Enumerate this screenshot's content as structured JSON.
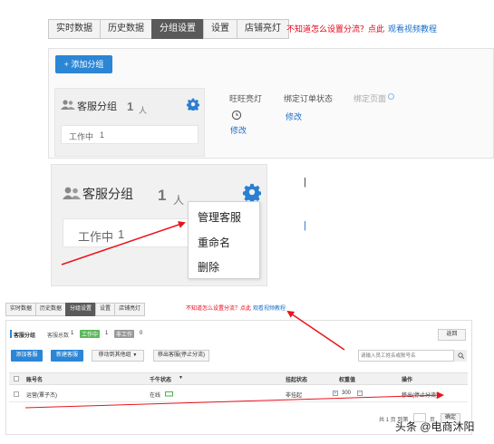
{
  "tabs": [
    "实时数据",
    "历史数据",
    "分组设置",
    "设置",
    "店铺亮灯"
  ],
  "active_tab": 2,
  "tip": {
    "text": "不知道怎么设置分流？点此",
    "link": "观看视频教程"
  },
  "panel1": {
    "add_button": "+ 添加分组",
    "group": {
      "name": "客服分组",
      "count": "1",
      "unit": "人",
      "status": "工作中",
      "status_count": "1"
    },
    "columns": [
      {
        "label": "旺旺亮灯",
        "action": "修改"
      },
      {
        "label": "绑定订单状态",
        "action": "修改"
      },
      {
        "label": "绑定页面",
        "action": ""
      }
    ]
  },
  "zoom": {
    "group": {
      "name": "客服分组",
      "count": "1",
      "unit": "人",
      "status": "工作中",
      "status_count": "1"
    },
    "menu": [
      "管理客服",
      "重命名",
      "删除"
    ]
  },
  "lower": {
    "tabs": [
      "实时数据",
      "历史数据",
      "分组设置",
      "设置",
      "店铺亮灯"
    ],
    "tip": {
      "text": "不知道怎么设置分流？点此",
      "link": "观看视频教程"
    },
    "group_label": "客服分组",
    "total_label": "客服总数",
    "total_value": "1",
    "working_badge": "工作中",
    "working_value": "1",
    "rest_badge": "非工作",
    "rest_value": "0",
    "back_button": "返回",
    "add_button": "添加客服",
    "create_button": "新建客服",
    "move_button": "移动到其他组",
    "remove_button": "移出客服(停止分流)",
    "search_placeholder": "请输入员工姓名或账号名",
    "headers": [
      "账号名",
      "千牛状态",
      "挂起状态",
      "权重值",
      "操作"
    ],
    "row": {
      "account": "运营(覃子杰)",
      "status": "在线",
      "suspend": "非挂起",
      "weight": "300",
      "action": "移出(停止分流)"
    },
    "pager": {
      "text1": "共 1 页 到第",
      "text2": "页",
      "confirm": "确定"
    }
  },
  "watermark": "头条 @电商沐阳",
  "colors": {
    "accent": "#2b86d6",
    "tip": "#e60012",
    "arrow": "#e8141b"
  }
}
